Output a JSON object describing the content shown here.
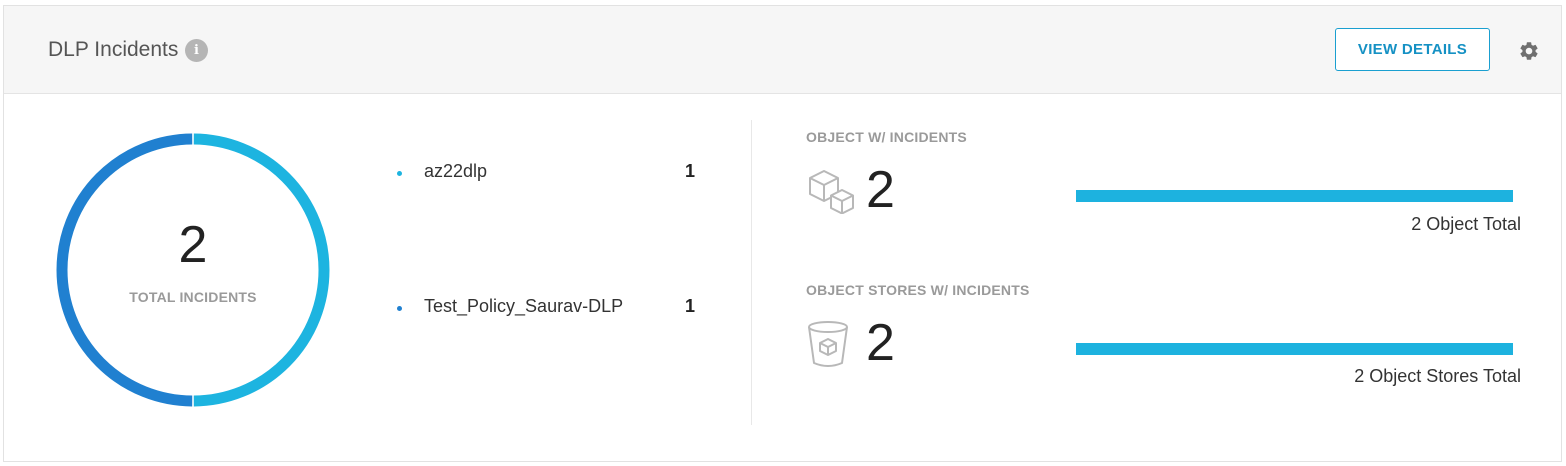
{
  "header": {
    "title": "DLP Incidents",
    "info_icon": "info-icon",
    "view_details_label": "VIEW DETAILS",
    "settings_icon": "gear-icon"
  },
  "donut": {
    "total": "2",
    "label": "TOTAL INCIDENTS",
    "segments": [
      {
        "name": "az22dlp",
        "value": 1,
        "color": "#1db4e0"
      },
      {
        "name": "Test_Policy_Saurav-DLP",
        "value": 1,
        "color": "#2080d0"
      }
    ]
  },
  "legend": [
    {
      "name": "az22dlp",
      "count": "1",
      "color": "#1db4e0"
    },
    {
      "name": "Test_Policy_Saurav-DLP",
      "count": "1",
      "color": "#2080d0"
    }
  ],
  "metrics": {
    "objects": {
      "title": "OBJECT W/ INCIDENTS",
      "icon": "cubes-icon",
      "value": "2",
      "fill_fraction": 1.0,
      "total_label": "2 Object Total"
    },
    "stores": {
      "title": "OBJECT STORES W/ INCIDENTS",
      "icon": "bucket-icon",
      "value": "2",
      "fill_fraction": 1.0,
      "total_label": "2 Object Stores Total"
    }
  },
  "colors": {
    "accent": "#1591c4",
    "bar_fill": "#1db2df"
  }
}
